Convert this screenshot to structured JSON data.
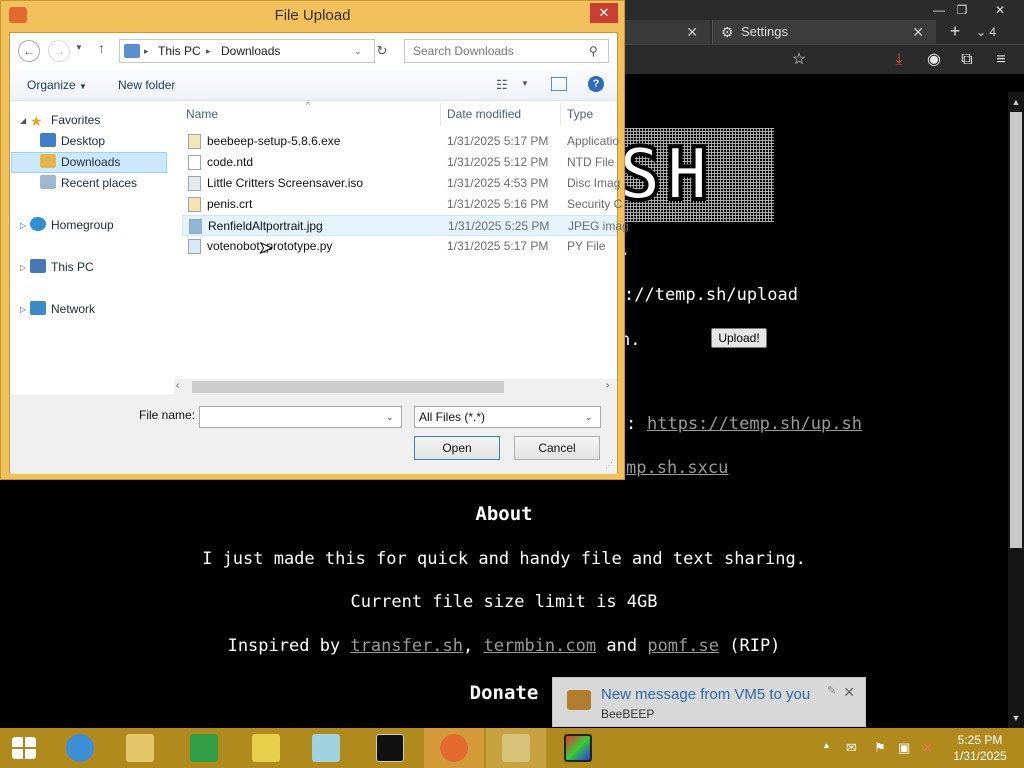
{
  "browser": {
    "tabs": [
      {
        "label": ""
      },
      {
        "label": "Settings"
      }
    ],
    "tab_count": "4",
    "page": {
      "upload_url_text": "://temp.sh/upload",
      "upload_button": "Upload!",
      "partial_dot1": ".",
      "partial_dot2": "n.",
      "colon": ":",
      "script_link": "https://temp.sh/up.sh",
      "sxcu_link": "mp.sh.sxcu",
      "about_heading": "About",
      "about_line1": "I just made this for quick and handy file and text sharing.",
      "about_line2": "Current file size limit is 4GB",
      "inspired_prefix": "Inspired by",
      "inspired_links": [
        "transfer.sh",
        "termbin.com",
        "pomf.se"
      ],
      "inspired_and": "and",
      "inspired_suffix": "(RIP)",
      "donate_heading": "Donate"
    }
  },
  "dialog": {
    "title": "File Upload",
    "breadcrumb": [
      "This PC",
      "Downloads"
    ],
    "search_placeholder": "Search Downloads",
    "organize_label": "Organize",
    "new_folder_label": "New folder",
    "nav_pane": {
      "favorites": "Favorites",
      "favorites_items": [
        "Desktop",
        "Downloads",
        "Recent places"
      ],
      "homegroup": "Homegroup",
      "this_pc": "This PC",
      "network": "Network",
      "selected": "Downloads"
    },
    "columns": {
      "name": "Name",
      "date": "Date modified",
      "type": "Type"
    },
    "files": [
      {
        "name": "beebeep-setup-5.8.6.exe",
        "date": "1/31/2025 5:17 PM",
        "type": "Applicatio"
      },
      {
        "name": "code.ntd",
        "date": "1/31/2025 5:12 PM",
        "type": "NTD File"
      },
      {
        "name": "Little Critters Screensaver.iso",
        "date": "1/31/2025 4:53 PM",
        "type": "Disc Imag"
      },
      {
        "name": "penis.crt",
        "date": "1/31/2025 5:16 PM",
        "type": "Security C"
      },
      {
        "name": "RenfieldAltportrait.jpg",
        "date": "1/31/2025 5:25 PM",
        "type": "JPEG imag"
      },
      {
        "name": "votenobot_prototype.py",
        "date": "1/31/2025 5:17 PM",
        "type": "PY File"
      }
    ],
    "selected_file": "RenfieldAltportrait.jpg",
    "file_name_label": "File name:",
    "file_name_value": "",
    "filter_value": "All Files (*.*)",
    "open_label": "Open",
    "cancel_label": "Cancel"
  },
  "notification": {
    "message": "New message from VM5 to you",
    "source": "BeeBEEP"
  },
  "taskbar": {
    "time": "5:25 PM",
    "date": "1/31/2025"
  },
  "colors": {
    "dialog_frame": "#f2c15c",
    "taskbar": "#b08a1c",
    "selection": "#cce8ff",
    "close_red": "#c94032"
  }
}
